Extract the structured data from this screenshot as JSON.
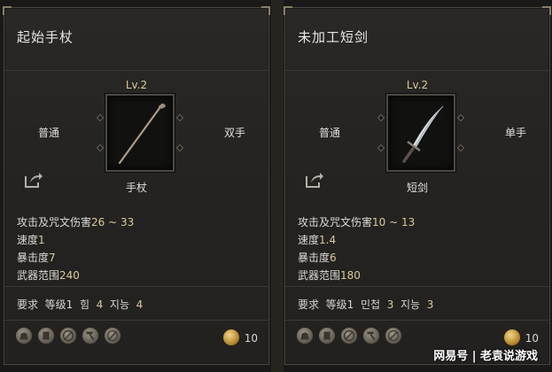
{
  "cards": [
    {
      "name": "起始手杖",
      "level": "Lv.2",
      "slot_left": "普通",
      "slot_right": "双手",
      "weapon_type": "手杖",
      "weapon_icon": "staff-icon",
      "stats": [
        {
          "label": "攻击及咒文伤害",
          "value": "26 ~ 33"
        },
        {
          "label": "速度",
          "value": "1"
        },
        {
          "label": "暴击度",
          "value": "7"
        },
        {
          "label": "武器范围",
          "value": "240"
        }
      ],
      "requirements": {
        "label": "要求",
        "level_label": "等级",
        "level_value": "1",
        "stat_1_label": "힘",
        "stat_1_value": "4",
        "stat_2_label": "지능",
        "stat_2_value": "4"
      },
      "price": "10"
    },
    {
      "name": "未加工短剑",
      "level": "Lv.2",
      "slot_left": "普通",
      "slot_right": "单手",
      "weapon_type": "短剑",
      "weapon_icon": "dagger-icon",
      "stats": [
        {
          "label": "攻击及咒文伤害",
          "value": "10 ~ 13"
        },
        {
          "label": "速度",
          "value": "1.4"
        },
        {
          "label": "暴击度",
          "value": "6"
        },
        {
          "label": "武器范围",
          "value": "180"
        }
      ],
      "requirements": {
        "label": "要求",
        "level_label": "等级",
        "level_value": "1",
        "stat_1_label": "민첩",
        "stat_1_value": "3",
        "stat_2_label": "지능",
        "stat_2_value": "3"
      },
      "price": "10"
    }
  ],
  "footer_icons": [
    "bag-icon",
    "scroll-icon",
    "no-trade-icon",
    "hammer-icon",
    "no-repair-icon"
  ],
  "watermark": "网易号 | 老袁说游戏",
  "colors": {
    "gold": "#d9c99a",
    "panel": "#252321",
    "border": "#4a4640"
  }
}
